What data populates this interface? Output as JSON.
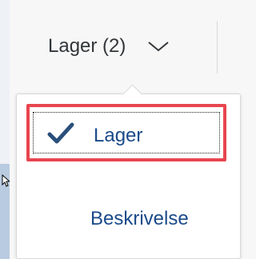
{
  "header": {
    "tab_label": "Lager (2)",
    "tab_icon": "chevron-down-icon"
  },
  "dropdown": {
    "items": [
      {
        "label": "Lager",
        "selected": true,
        "icon": "checkmark-icon"
      },
      {
        "label": "Beskrivelse",
        "selected": false
      }
    ]
  },
  "colors": {
    "accent_text": "#1a4a8a",
    "checkmark": "#2a4f7a",
    "highlight_border": "#e8454f",
    "header_text": "#32363a"
  }
}
